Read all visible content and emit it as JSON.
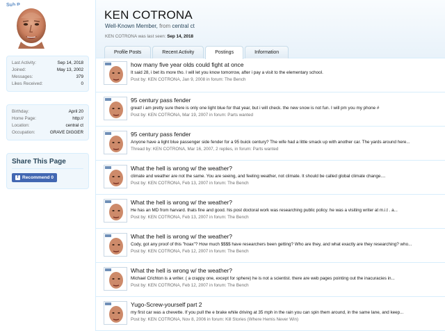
{
  "sidebar": {
    "tag": "Sub P",
    "stats": [
      {
        "label": "Last Activity:",
        "value": "Sep 14, 2018"
      },
      {
        "label": "Joined:",
        "value": "May 13, 2002"
      },
      {
        "label": "Messages:",
        "value": "379"
      },
      {
        "label": "Likes Received:",
        "value": "0"
      }
    ],
    "details": [
      {
        "label": "Birthday:",
        "value": "April 20"
      },
      {
        "label": "Home Page:",
        "value": "http://"
      },
      {
        "label": "Location:",
        "value": "central ct"
      },
      {
        "label": "Occupation:",
        "value": "GRAVE DIGGER"
      }
    ],
    "share_title": "Share This Page",
    "fb_label": "Recommend 0"
  },
  "header": {
    "username": "KEN COTRONA",
    "title": "Well-Known Member,",
    "from_label": "from",
    "location": "central ct",
    "lastseen_prefix": "KEN COTRONA was last seen:",
    "lastseen_date": "Sep 14, 2018"
  },
  "tabs": [
    {
      "label": "Profile Posts"
    },
    {
      "label": "Recent Activity"
    },
    {
      "label": "Postings"
    },
    {
      "label": "Information"
    }
  ],
  "active_tab": "Postings",
  "posts": [
    {
      "title": "how many five year olds could fight at once",
      "snippet": "It said 28, i bet its more tho. I will let you know tomorrow, after i pay a visit to the elementary school.",
      "meta": "Post by: KEN COTRONA, Jan 9, 2008 in forum: The Bench"
    },
    {
      "title": "95 century pass fender",
      "snippet": "great! i am pretty sure there is only one light blue for that year, but i will check. the new snow is not fun. I will pm you my phone #",
      "meta": "Post by: KEN COTRONA, Mar 19, 2007 in forum: Parts wanted"
    },
    {
      "title": "95 century pass fender",
      "snippet": "Anyone have a light blue passenger side fender for a 95 buick century? The wife had a little smack up with another car. The yards around here...",
      "meta": "Thread by: KEN COTRONA, Mar 16, 2007, 2 replies, in forum: Parts wanted"
    },
    {
      "title": "What the hell is wrong w/ the weather?",
      "snippet": "climate and weather are not the same. You are seeing, and feeling weather, not climate. It should be called global climate change....",
      "meta": "Post by: KEN COTRONA, Feb 13, 2007 in forum: The Bench"
    },
    {
      "title": "What the hell is wrong w/ the weather?",
      "snippet": "He has an MD from harvard. thats fine and good. his post doctoral work was researching public policy. he was a visiting writer at m.i.t . a...",
      "meta": "Post by: KEN COTRONA, Feb 13, 2007 in forum: The Bench"
    },
    {
      "title": "What the hell is wrong w/ the weather?",
      "snippet": "Cody, got any proof of this \"hoax\"? How much $$$$ have researchers been getting? Who are they, and what exactly are they researching? who...",
      "meta": "Post by: KEN COTRONA, Feb 12, 2007 in forum: The Bench"
    },
    {
      "title": "What the hell is wrong w/ the weather?",
      "snippet": "Michael Crichton is a writer. ( a crappy one, except for sphere) he is not a scientist. there are web pages pointing out the inacuracies in...",
      "meta": "Post by: KEN COTRONA, Feb 12, 2007 in forum: The Bench"
    },
    {
      "title": "Yugo-Screw-yourself part 2",
      "snippet": "my first car was a chevette. If you pull the e brake while driving at 35 mph in the rain you can spin them around, in the same lane, and keep...",
      "meta": "Post by: KEN COTRONA, Nov 8, 2006 in forum: Kill Stories (Where Hemis Never Win)"
    }
  ]
}
